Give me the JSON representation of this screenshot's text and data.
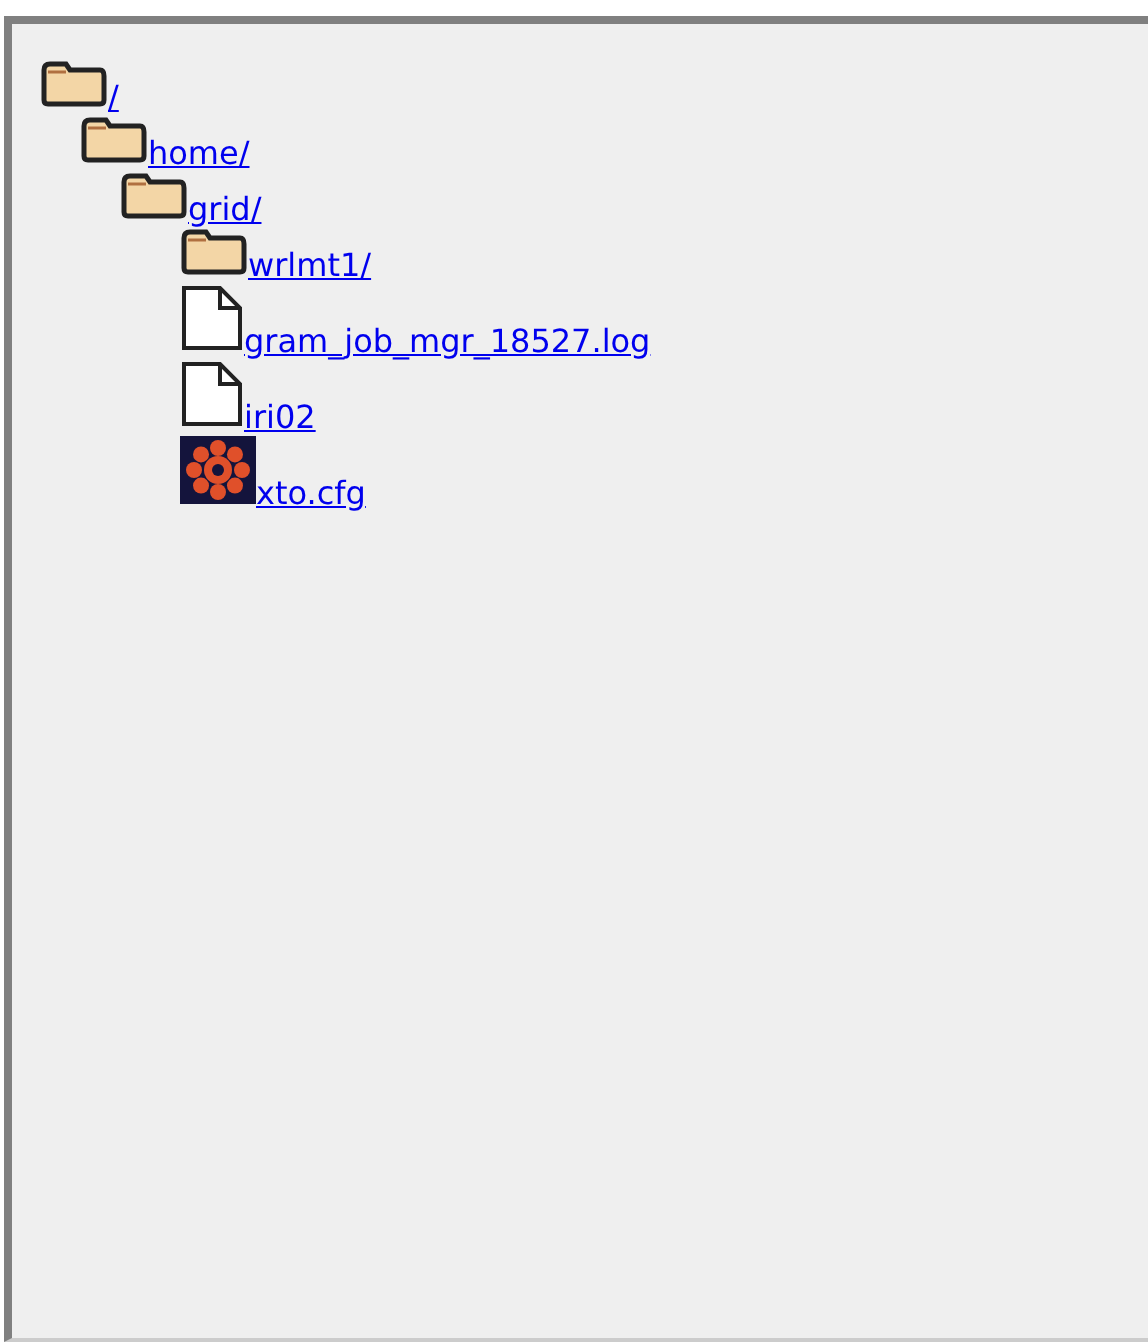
{
  "tree": [
    {
      "name": "/",
      "kind": "folder",
      "children": [
        {
          "name": "home/",
          "kind": "folder",
          "children": [
            {
              "name": "grid/",
              "kind": "folder",
              "children": [
                {
                  "name": "wrlmt1/",
                  "kind": "folder"
                },
                {
                  "name": "gram_job_mgr_18527.log",
                  "kind": "file"
                },
                {
                  "name": "iri02",
                  "kind": "file"
                },
                {
                  "name": "xto.cfg",
                  "kind": "image"
                }
              ]
            }
          ]
        }
      ]
    }
  ]
}
